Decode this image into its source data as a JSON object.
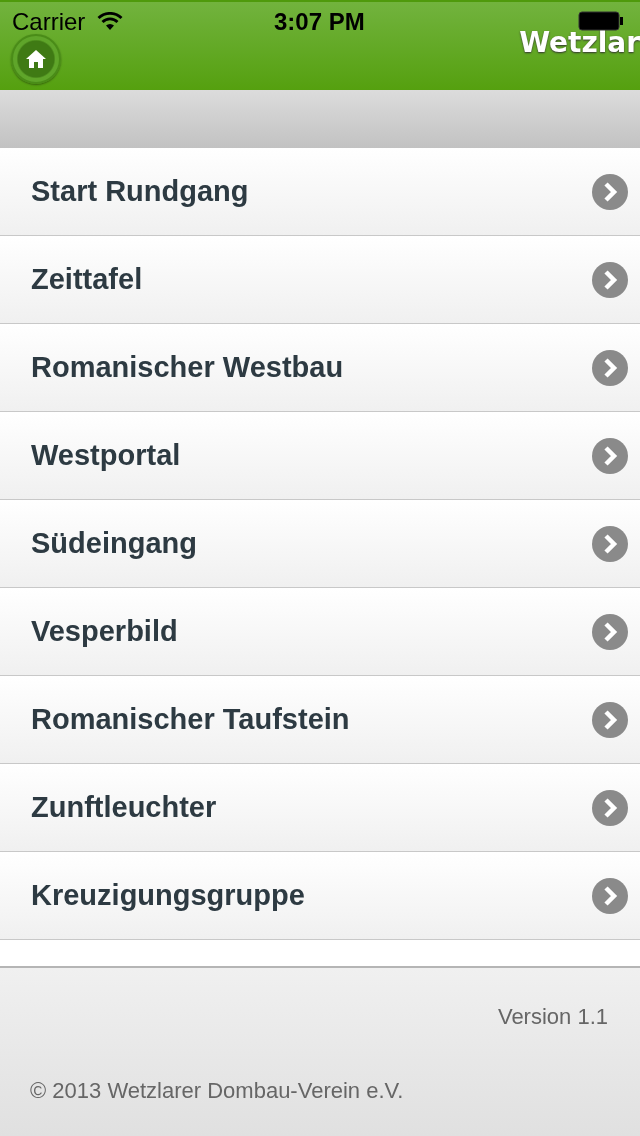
{
  "status_bar": {
    "carrier": "Carrier",
    "time": "3:07 PM"
  },
  "header": {
    "title": "Wetzlar"
  },
  "menu": [
    {
      "label": "Start Rundgang"
    },
    {
      "label": "Zeittafel"
    },
    {
      "label": "Romanischer Westbau"
    },
    {
      "label": "Westportal"
    },
    {
      "label": "Südeingang"
    },
    {
      "label": "Vesperbild"
    },
    {
      "label": "Romanischer Taufstein"
    },
    {
      "label": "Zunftleuchter"
    },
    {
      "label": "Kreuzigungsgruppe"
    }
  ],
  "footer": {
    "version": "Version 1.1",
    "copyright": "© 2013 Wetzlarer Dombau-Verein e.V."
  }
}
